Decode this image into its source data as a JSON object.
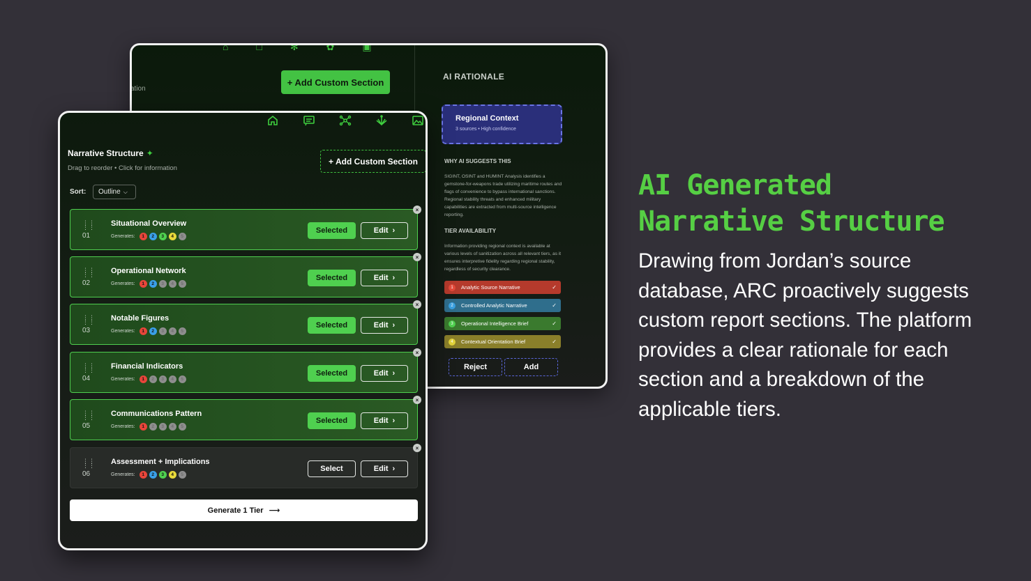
{
  "back_panel": {
    "add_custom_section": "+ Add Custom Section",
    "partial_label": "ation",
    "rationale": {
      "title": "AI RATIONALE",
      "card_title": "Regional Context",
      "card_sub": "3 sources • High confidence",
      "why_title": "WHY AI SUGGESTS THIS",
      "why_body": "SIGINT, OSINT and HUMINT Analysis identifies a gemstone-for-weapons trade utilizing maritime routes and flags of convenience to bypass international sanctions. Regional stability threats and enhanced military capabilities are extracted from multi-source intelligence reporting.",
      "tier_title": "TIER AVAILABILITY",
      "tier_body": "Information providing regional context is available at various levels of sanitization across all relevant tiers, as it ensures interpretive fidelity regarding regional stability, regardless of security clearance.",
      "tiers": [
        {
          "num": "1",
          "label": "Analytic Source Narrative",
          "bg": "#b53a2c",
          "dot": "#e34a3a"
        },
        {
          "num": "2",
          "label": "Controlled Analytic Narrative",
          "bg": "#2f6e8c",
          "dot": "#3aa0e0"
        },
        {
          "num": "3",
          "label": "Operational Intelligence Brief",
          "bg": "#3a7a2e",
          "dot": "#4fcf4f"
        },
        {
          "num": "4",
          "label": "Contextual Orientation Brief",
          "bg": "#8a7f2a",
          "dot": "#e0d23a"
        }
      ],
      "check": "✓",
      "reject_label": "Reject",
      "add_label": "Add"
    }
  },
  "front_panel": {
    "title": "Narrative Structure",
    "subtitle": "Drag to reorder • Click for information",
    "add_custom_section": "+ Add Custom Section",
    "sort_label": "Sort:",
    "sort_value": "Outline",
    "generates_label": "Generates:",
    "sections": [
      {
        "num": "01",
        "title": "Situational Overview",
        "state": "Selected",
        "active": [
          true,
          true,
          true,
          true,
          false
        ]
      },
      {
        "num": "02",
        "title": "Operational Network",
        "state": "Selected",
        "active": [
          true,
          true,
          false,
          false,
          false
        ]
      },
      {
        "num": "03",
        "title": "Notable Figures",
        "state": "Selected",
        "active": [
          true,
          true,
          false,
          false,
          false
        ]
      },
      {
        "num": "04",
        "title": "Financial Indicators",
        "state": "Selected",
        "active": [
          true,
          false,
          false,
          false,
          false
        ]
      },
      {
        "num": "05",
        "title": "Communications Pattern",
        "state": "Selected",
        "active": [
          true,
          false,
          false,
          false,
          false
        ]
      },
      {
        "num": "06",
        "title": "Assessment + Implications",
        "state": "Select",
        "active": [
          true,
          true,
          true,
          true,
          false
        ]
      }
    ],
    "edit_label": "Edit",
    "generate_label": "Generate 1 Tier"
  },
  "colors": {
    "dot_active": [
      "#e8453a",
      "#3a9fe8",
      "#4fd04f",
      "#e8d93a",
      "#8e8e8e"
    ],
    "dot_inactive": "#8e8e8e",
    "accent": "#56cf44"
  },
  "headline_lines": [
    "AI Generated",
    "Narrative Structure"
  ],
  "description": "Drawing from Jordan’s source database, ARC proactively suggests custom report sections. The platform provides a clear rationale for each section and a breakdown of the applicable tiers."
}
